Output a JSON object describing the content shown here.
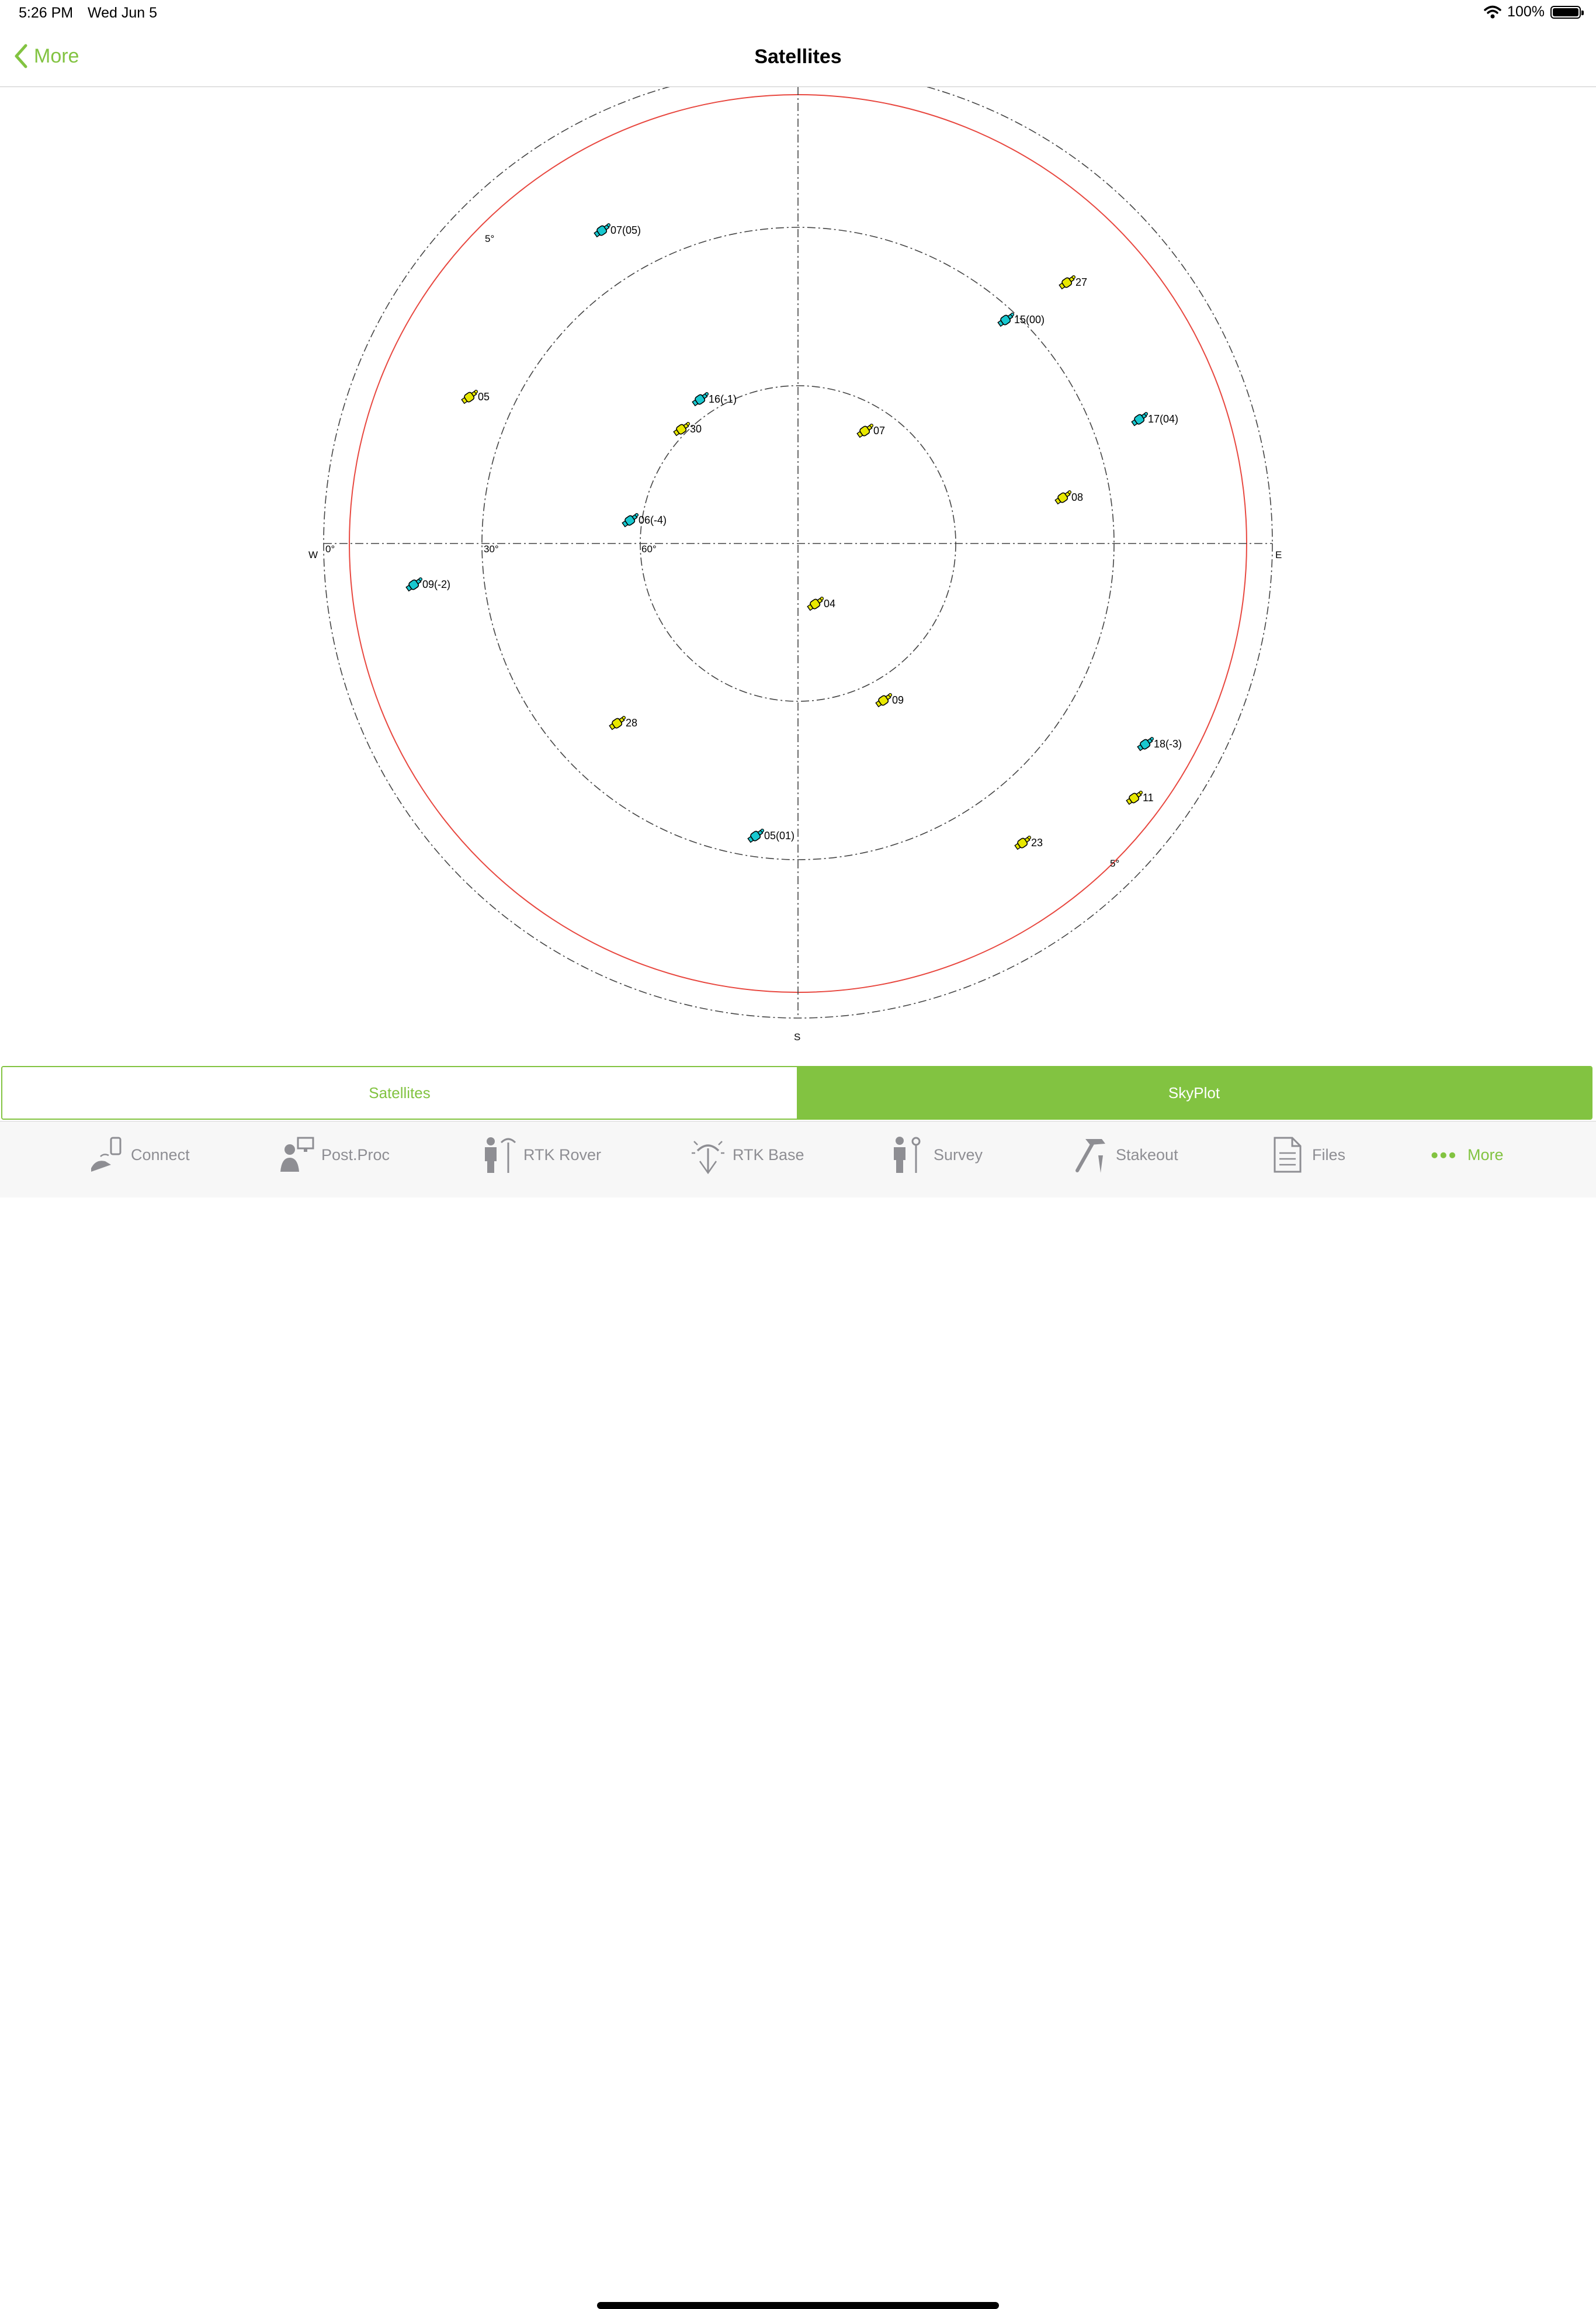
{
  "status_bar": {
    "time": "5:26 PM",
    "date": "Wed Jun 5",
    "battery": "100%"
  },
  "nav": {
    "back_label": "More",
    "title": "Satellites"
  },
  "skyplot": {
    "directions": {
      "west": "W",
      "east": "E",
      "south": "S"
    },
    "elevation_labels": [
      "0°",
      "30°",
      "60°"
    ],
    "mask_labels": [
      "5°",
      "5°"
    ],
    "colors": {
      "gps": "#e8e800",
      "glonass": "#18c8d0",
      "mask": "#e8473f"
    },
    "satellites": [
      {
        "label": "07(05)",
        "type": "glonass"
      },
      {
        "label": "27",
        "type": "gps"
      },
      {
        "label": "15(00)",
        "type": "glonass"
      },
      {
        "label": "05",
        "type": "gps"
      },
      {
        "label": "16(-1)",
        "type": "glonass"
      },
      {
        "label": "30",
        "type": "gps"
      },
      {
        "label": "07",
        "type": "gps"
      },
      {
        "label": "17(04)",
        "type": "glonass"
      },
      {
        "label": "08",
        "type": "gps"
      },
      {
        "label": "06(-4)",
        "type": "glonass"
      },
      {
        "label": "09(-2)",
        "type": "glonass"
      },
      {
        "label": "04",
        "type": "gps"
      },
      {
        "label": "09",
        "type": "gps"
      },
      {
        "label": "28",
        "type": "gps"
      },
      {
        "label": "18(-3)",
        "type": "glonass"
      },
      {
        "label": "11",
        "type": "gps"
      },
      {
        "label": "05(01)",
        "type": "glonass"
      },
      {
        "label": "23",
        "type": "gps"
      }
    ]
  },
  "segmented": {
    "left": "Satellites",
    "right": "SkyPlot"
  },
  "tabs": [
    {
      "label": "Connect",
      "icon": "connect-icon"
    },
    {
      "label": "Post.Proc",
      "icon": "post-proc-icon"
    },
    {
      "label": "RTK Rover",
      "icon": "rtk-rover-icon"
    },
    {
      "label": "RTK Base",
      "icon": "rtk-base-icon"
    },
    {
      "label": "Survey",
      "icon": "survey-icon"
    },
    {
      "label": "Stakeout",
      "icon": "stakeout-icon"
    },
    {
      "label": "Files",
      "icon": "files-icon"
    },
    {
      "label": "More",
      "icon": "more-dots-icon"
    }
  ]
}
